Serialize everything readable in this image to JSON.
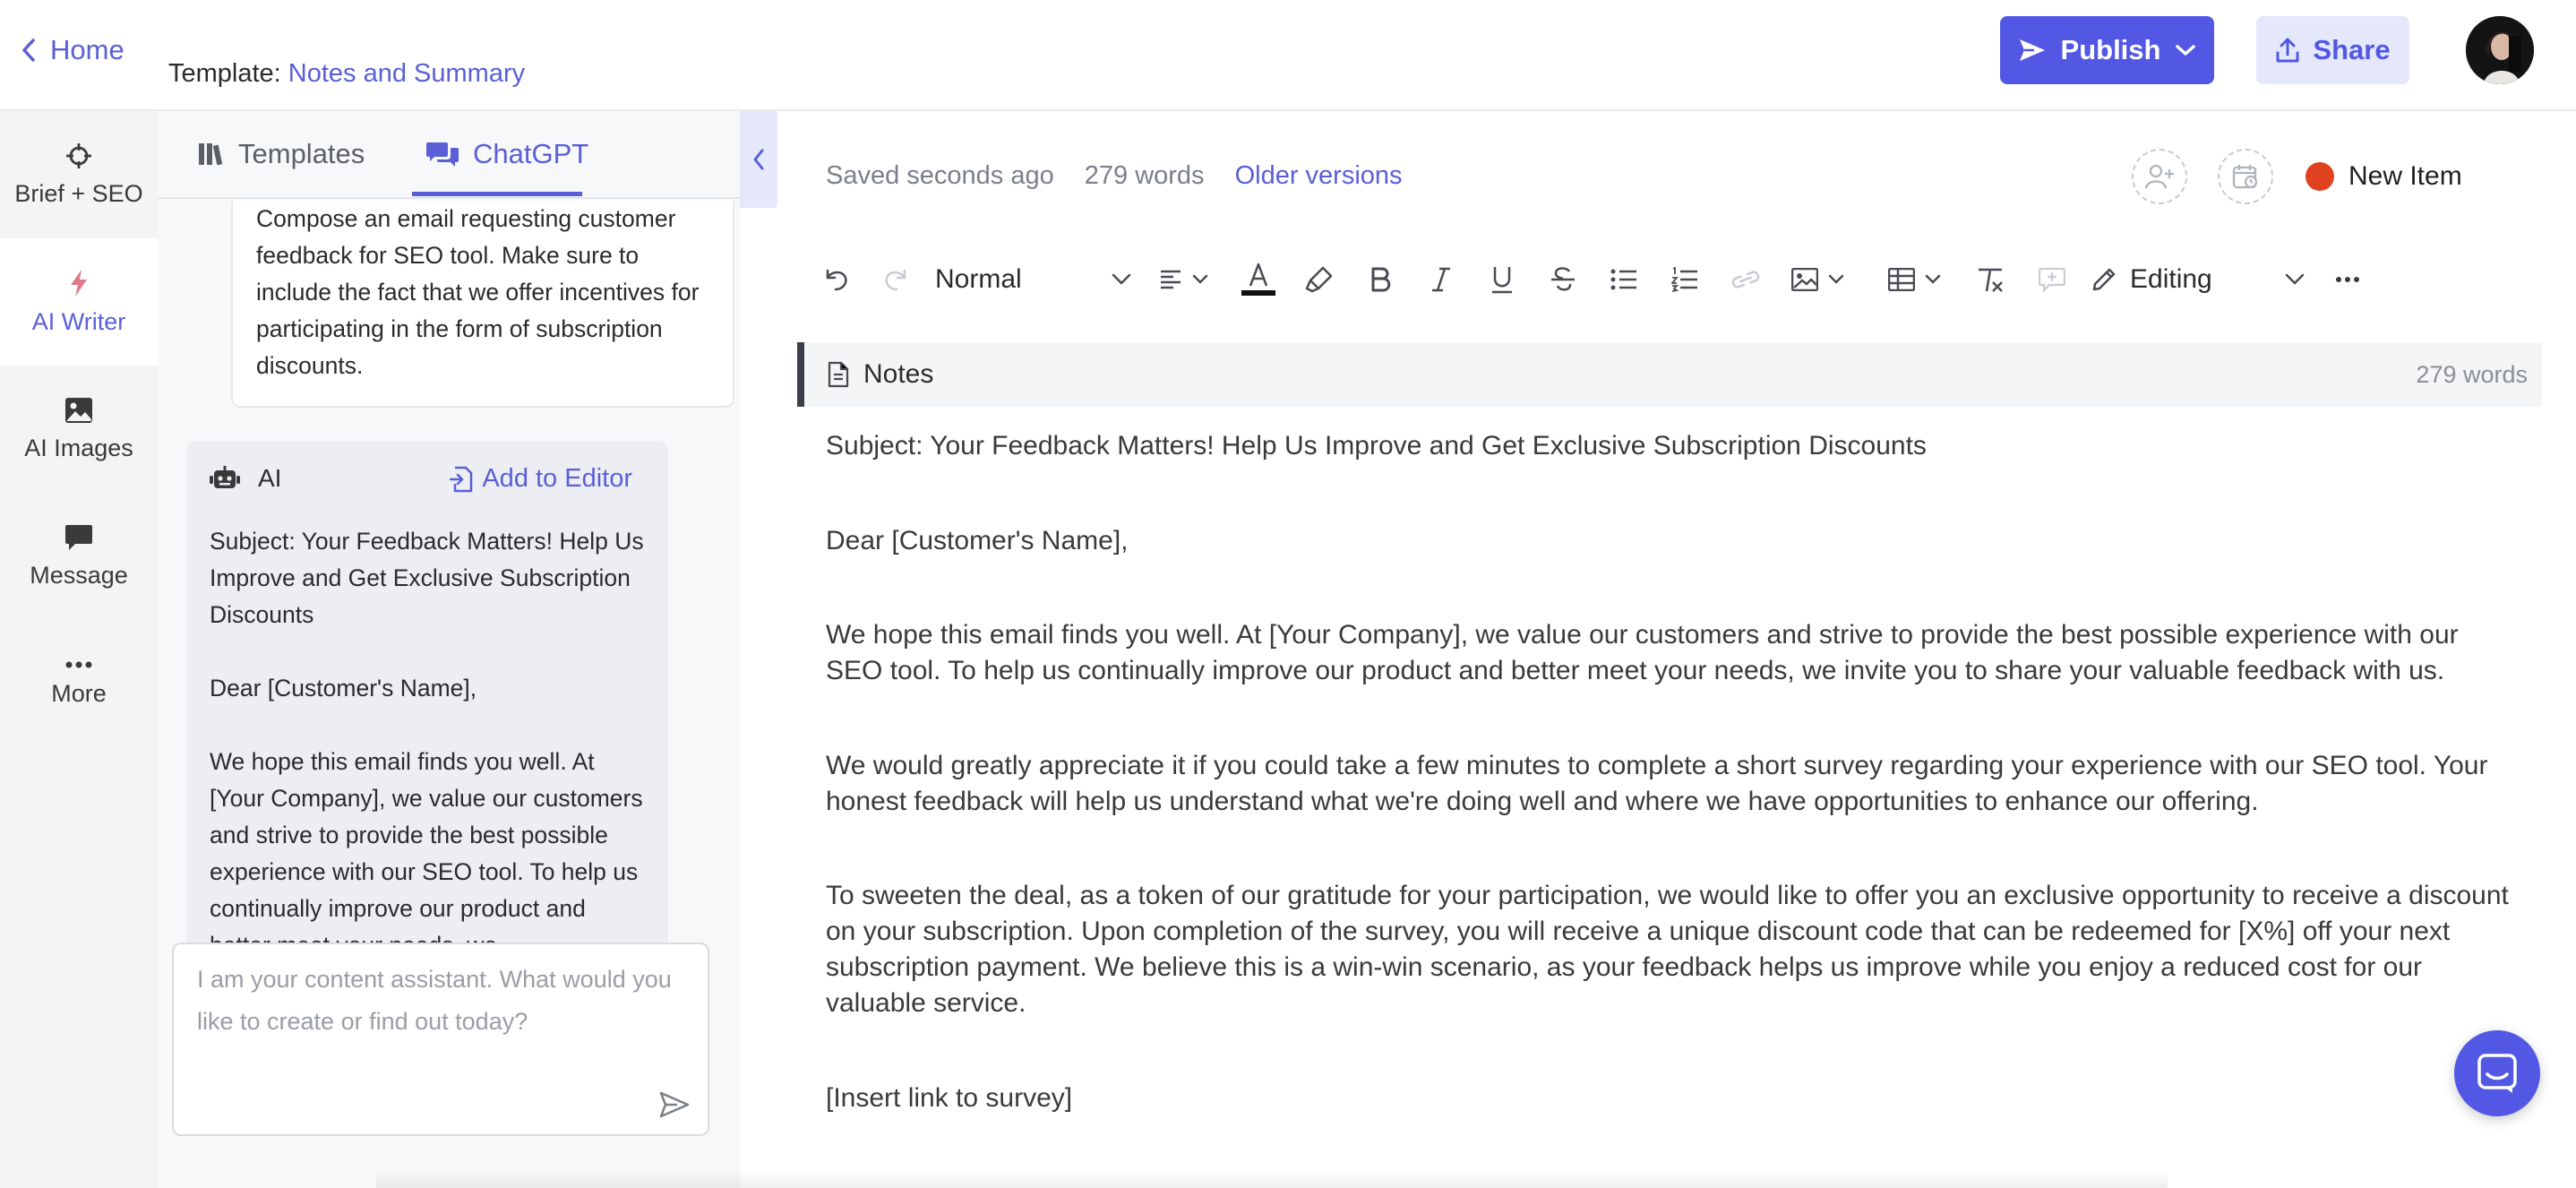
{
  "header": {
    "home_label": "Home",
    "template_prefix": "Template: ",
    "template_name": "Notes and Summary",
    "publish_label": "Publish",
    "share_label": "Share"
  },
  "rail": {
    "items": [
      {
        "label": "Brief + SEO",
        "icon": "crosshair-icon"
      },
      {
        "label": "AI Writer",
        "icon": "lightning-icon"
      },
      {
        "label": "AI Images",
        "icon": "image-icon"
      },
      {
        "label": "Message",
        "icon": "chat-bubble-icon"
      },
      {
        "label": "More",
        "icon": "more-dots-icon"
      }
    ]
  },
  "panel": {
    "tabs": [
      {
        "label": "Templates",
        "icon": "library-icon"
      },
      {
        "label": "ChatGPT",
        "icon": "chats-icon"
      }
    ],
    "user_message": "Compose an email requesting customer feedback for SEO tool. Make sure to include the fact that we offer incentives for participating in the form of subscription discounts.",
    "ai_label": "AI",
    "add_to_editor_label": "Add to Editor",
    "ai_paragraphs": [
      "Subject: Your Feedback Matters! Help Us Improve and Get Exclusive Subscription Discounts",
      "Dear [Customer's Name],",
      "We hope this email finds you well. At [Your Company], we value our customers and strive to provide the best possible experience with our SEO tool. To help us continually improve our product and better meet your needs, we"
    ],
    "input_placeholder": "I am your content assistant. What would you like to create or find out today?"
  },
  "editor": {
    "saved_status": "Saved seconds ago",
    "word_count": "279 words",
    "older_versions_label": "Older versions",
    "status_label": "New Item",
    "status_color": "#e0411f",
    "toolbar": {
      "paragraph_style": "Normal",
      "mode": "Editing"
    },
    "notes_title": "Notes",
    "notes_words": "279 words",
    "paragraphs": [
      "Subject: Your Feedback Matters! Help Us Improve and Get Exclusive Subscription Discounts",
      "Dear [Customer's Name],",
      "We hope this email finds you well. At [Your Company], we value our customers and strive to provide the best possible experience with our SEO tool. To help us continually improve our product and better meet your needs, we invite you to share your valuable feedback with us.",
      "We would greatly appreciate it if you could take a few minutes to complete a short survey regarding your experience with our SEO tool. Your honest feedback will help us understand what we're doing well and where we have opportunities to enhance our offering.",
      "To sweeten the deal, as a token of our gratitude for your participation, we would like to offer you an exclusive opportunity to receive a discount on your subscription. Upon completion of the survey, you will receive a unique discount code that can be redeemed for [X%] off your next subscription payment. We believe this is a win-win scenario, as your feedback helps us improve while you enjoy a reduced cost for our valuable service.",
      "[Insert link to survey]"
    ]
  },
  "colors": {
    "accent": "#5258e4",
    "link": "#5a5fd6"
  }
}
